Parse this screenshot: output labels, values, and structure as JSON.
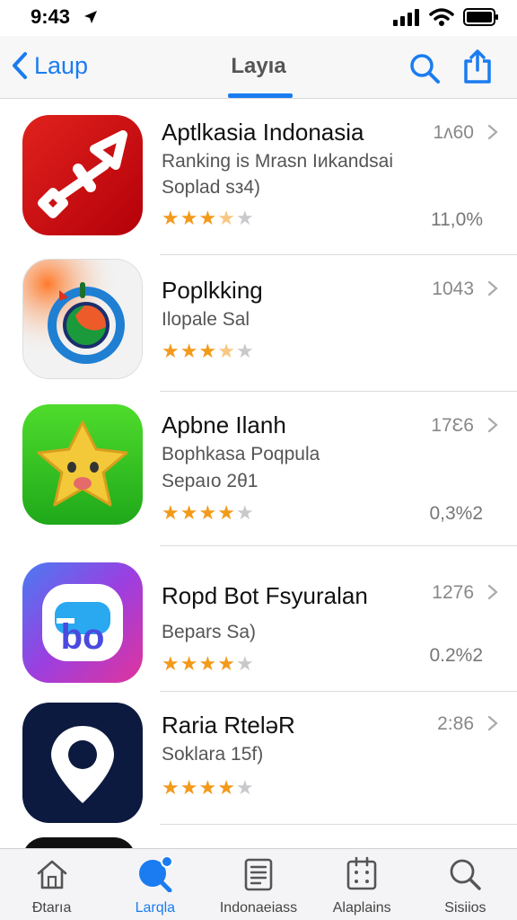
{
  "status_bar": {
    "time": "9:43"
  },
  "nav": {
    "back_label": "Laup",
    "title": "Layıa"
  },
  "apps": [
    {
      "name": "Aptlkasia Indonasia",
      "subtitle": "Ranking is Mrasn Iиkandsai",
      "subtitle2": "Soplad sз4)",
      "rating_stars": 3.5,
      "count": "1ᴧ60",
      "percent": "11,0%",
      "icon": "red-wrench-icon"
    },
    {
      "name": "Poplkking",
      "subtitle": "Ilopale Sal",
      "subtitle2": "",
      "rating_stars": 3.5,
      "count": "1043",
      "percent": "",
      "icon": "target-circle-icon"
    },
    {
      "name": "Apbne Ilanh",
      "subtitle": "Bophkasa Poqpula",
      "subtitle2": "Sepaıo 2θ1",
      "rating_stars": 4,
      "count": "17Ɛ6",
      "percent": "0,3%2",
      "icon": "star-face-icon"
    },
    {
      "name": "Ropd Bot Fsyuralan",
      "subtitle": "Bepars Sa)",
      "subtitle2": "",
      "rating_stars": 4,
      "count": "1276",
      "percent": "0.2%2",
      "icon": "bo-logo-icon"
    },
    {
      "name": "Raria RtelәR",
      "subtitle": "Soklara 15f)",
      "subtitle2": "",
      "rating_stars": 4,
      "count": "2:86",
      "percent": "",
      "icon": "location-pin-icon"
    }
  ],
  "tabs": [
    {
      "label": "Ðtarıa",
      "icon": "home-icon",
      "active": false
    },
    {
      "label": "Larqla",
      "icon": "search-bubble-icon",
      "active": true
    },
    {
      "label": "Indonaeiass",
      "icon": "list-document-icon",
      "active": false
    },
    {
      "label": "Alaplains",
      "icon": "apps-grid-icon",
      "active": false
    },
    {
      "label": "Sisiios",
      "icon": "search-icon",
      "active": false
    }
  ],
  "colors": {
    "accent": "#1a7cf0",
    "star": "#f39a1b"
  }
}
